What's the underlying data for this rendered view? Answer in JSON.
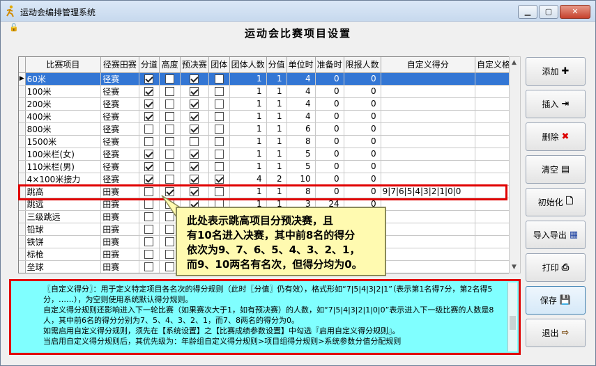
{
  "window": {
    "title": "运动会编排管理系统",
    "controls": {
      "minimize": "▁",
      "maximize": "▢",
      "close": "✕"
    }
  },
  "page_title": "运动会比赛项目设置",
  "grid": {
    "columns": [
      "比赛项目",
      "径赛田赛",
      "分道",
      "高度",
      "预决赛",
      "团体",
      "团体人数",
      "分值",
      "单位时",
      "准备时",
      "限报人数",
      "自定义得分",
      "自定义格"
    ],
    "rows": [
      {
        "name": "60米",
        "type": "径赛",
        "lane": true,
        "height": false,
        "prelim": true,
        "team": false,
        "team_count": "1",
        "score": "1",
        "unit_time": "4",
        "prep_time": "0",
        "limit": "0",
        "custom": "",
        "selected": true
      },
      {
        "name": "100米",
        "type": "径赛",
        "lane": true,
        "height": false,
        "prelim": true,
        "team": false,
        "team_count": "1",
        "score": "1",
        "unit_time": "4",
        "prep_time": "0",
        "limit": "0",
        "custom": ""
      },
      {
        "name": "200米",
        "type": "径赛",
        "lane": true,
        "height": false,
        "prelim": true,
        "team": false,
        "team_count": "1",
        "score": "1",
        "unit_time": "4",
        "prep_time": "0",
        "limit": "0",
        "custom": ""
      },
      {
        "name": "400米",
        "type": "径赛",
        "lane": true,
        "height": false,
        "prelim": true,
        "team": false,
        "team_count": "1",
        "score": "1",
        "unit_time": "4",
        "prep_time": "0",
        "limit": "0",
        "custom": ""
      },
      {
        "name": "800米",
        "type": "径赛",
        "lane": false,
        "height": false,
        "prelim": true,
        "team": false,
        "team_count": "1",
        "score": "1",
        "unit_time": "6",
        "prep_time": "0",
        "limit": "0",
        "custom": ""
      },
      {
        "name": "1500米",
        "type": "径赛",
        "lane": false,
        "height": false,
        "prelim": false,
        "team": false,
        "team_count": "1",
        "score": "1",
        "unit_time": "8",
        "prep_time": "0",
        "limit": "0",
        "custom": ""
      },
      {
        "name": "100米栏(女)",
        "type": "径赛",
        "lane": true,
        "height": false,
        "prelim": true,
        "team": false,
        "team_count": "1",
        "score": "1",
        "unit_time": "5",
        "prep_time": "0",
        "limit": "0",
        "custom": ""
      },
      {
        "name": "110米栏(男)",
        "type": "径赛",
        "lane": true,
        "height": false,
        "prelim": true,
        "team": false,
        "team_count": "1",
        "score": "1",
        "unit_time": "5",
        "prep_time": "0",
        "limit": "0",
        "custom": ""
      },
      {
        "name": "4×100米接力",
        "type": "径赛",
        "lane": true,
        "height": false,
        "prelim": true,
        "team": true,
        "team_count": "4",
        "score": "2",
        "unit_time": "10",
        "prep_time": "0",
        "limit": "0",
        "custom": ""
      },
      {
        "name": "跳高",
        "type": "田赛",
        "lane": false,
        "height": true,
        "prelim": true,
        "team": false,
        "team_count": "1",
        "score": "1",
        "unit_time": "8",
        "prep_time": "0",
        "limit": "0",
        "custom": "9|7|6|5|4|3|2|1|0|0"
      },
      {
        "name": "跳远",
        "type": "田赛",
        "lane": false,
        "height": false,
        "prelim": true,
        "team": false,
        "team_count": "1",
        "score": "1",
        "unit_time": "3",
        "prep_time": "24",
        "limit": "0",
        "custom": ""
      },
      {
        "name": "三级跳远",
        "type": "田赛",
        "lane": false,
        "height": false,
        "prelim": true,
        "team": false,
        "team_count": "",
        "score": "",
        "unit_time": "",
        "prep_time": "",
        "limit": "",
        "custom": ""
      },
      {
        "name": "铅球",
        "type": "田赛",
        "lane": false,
        "height": false,
        "prelim": false,
        "team": false,
        "team_count": "",
        "score": "",
        "unit_time": "",
        "prep_time": "",
        "limit": "",
        "custom": ""
      },
      {
        "name": "铁饼",
        "type": "田赛",
        "lane": false,
        "height": false,
        "prelim": false,
        "team": false,
        "team_count": "",
        "score": "",
        "unit_time": "",
        "prep_time": "",
        "limit": "",
        "custom": ""
      },
      {
        "name": "标枪",
        "type": "田赛",
        "lane": false,
        "height": false,
        "prelim": false,
        "team": false,
        "team_count": "",
        "score": "",
        "unit_time": "",
        "prep_time": "",
        "limit": "",
        "custom": ""
      },
      {
        "name": "垒球",
        "type": "田赛",
        "lane": false,
        "height": false,
        "prelim": false,
        "team": false,
        "team_count": "",
        "score": "",
        "unit_time": "",
        "prep_time": "",
        "limit": "",
        "custom": ""
      }
    ]
  },
  "callout": [
    "此处表示跳高项目分预决赛，且",
    "有10名进入决赛，其中前8名的得分",
    "依次为9、7、6、5、4、3、2、1，",
    "而9、10两名有名次，但得分均为0。"
  ],
  "note": [
    "〖自定义得分〗：用于定义特定项目各名次的得分规则（此时〖分值〗仍有效），格式形如“7|5|4|3|2|1”（表示第1名得7分，第2名得5分，……），为空则使用系统默认得分规则。",
    "自定义得分规则还影响进入下一轮比赛（如果赛次大于1，如有预决赛）的人数，如“7|5|4|3|2|1|0|0”表示进入下一级比赛的人数是8人，其中前6名的得分分别为7、5、4、3、2、1，而7、8两名的得分为0。",
    "如需启用自定义得分规则，须先在【系统设置】之【比赛成绩参数设置】中勾选『启用自定义得分规则』。",
    "当启用自定义得分规则后，其优先级为：年龄组自定义得分规则>项目组得分规则>系统参数分值分配规则"
  ],
  "buttons": [
    {
      "label": "添加",
      "icon": "plus-icon",
      "glyph": "✚"
    },
    {
      "label": "插入",
      "icon": "insert-icon",
      "glyph": "⇥"
    },
    {
      "label": "删除",
      "icon": "delete-icon",
      "glyph": "✖"
    },
    {
      "label": "清空",
      "icon": "clear-icon",
      "glyph": "▤"
    },
    {
      "label": "初始化",
      "icon": "document-icon",
      "glyph": "🗋"
    },
    {
      "label": "导入导出",
      "icon": "import-export-icon",
      "glyph": "▦"
    },
    {
      "label": "打印",
      "icon": "printer-icon",
      "glyph": "⎙"
    },
    {
      "label": "保存",
      "icon": "save-icon",
      "glyph": "💾"
    },
    {
      "label": "退出",
      "icon": "exit-icon",
      "glyph": "⇨"
    }
  ],
  "colors": {
    "selection": "#3376d4",
    "highlight_border": "#e00000",
    "note_bg": "#80ffff",
    "callout_bg": "#fffab0"
  }
}
